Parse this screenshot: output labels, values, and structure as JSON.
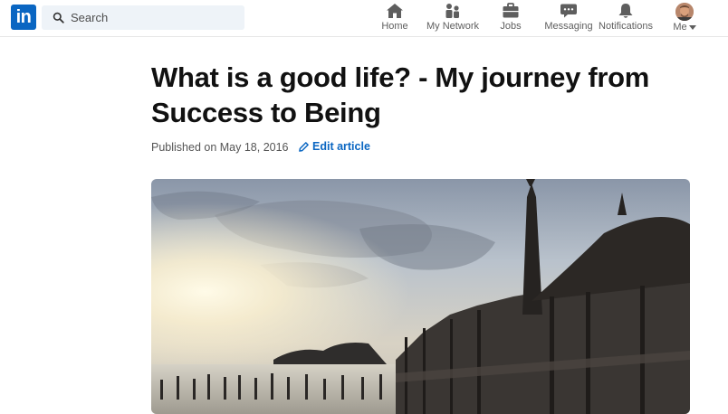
{
  "brand": {
    "logo_text": "in",
    "color": "#0a66c2"
  },
  "search": {
    "placeholder": "Search",
    "value": ""
  },
  "nav": {
    "items": [
      {
        "label": "Home",
        "icon": "home-icon"
      },
      {
        "label": "My Network",
        "icon": "network-icon"
      },
      {
        "label": "Jobs",
        "icon": "briefcase-icon"
      },
      {
        "label": "Messaging",
        "icon": "message-icon"
      },
      {
        "label": "Notifications",
        "icon": "bell-icon"
      },
      {
        "label": "Me",
        "icon": "avatar"
      }
    ]
  },
  "article": {
    "title": "What is a good life? - My journey from Success to Being",
    "published": "Published on May 18, 2016",
    "edit_label": "Edit article",
    "hero_image": "temple-at-sunset-photo"
  }
}
